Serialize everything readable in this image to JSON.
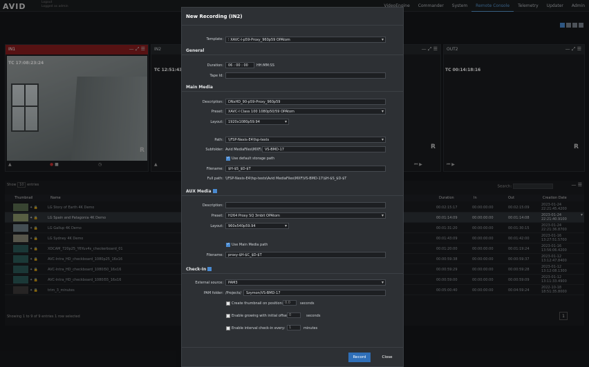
{
  "header": {
    "logo": "AVID",
    "user_line1": "Logout",
    "user_line2": "Logged as admin",
    "nav": [
      "VideoEngine",
      "Commander",
      "System",
      "Remote Console",
      "Telemetry",
      "Updater",
      "Admin"
    ],
    "active_nav": "Remote Console"
  },
  "channels": [
    {
      "name": "IN1",
      "tc": "TC 17:08:23:24"
    },
    {
      "name": "IN2",
      "tc": "TC 12:51:43:26"
    },
    {
      "name": "OUT2",
      "tc": "TC 00:14:18:16"
    }
  ],
  "list": {
    "show_label": "Show",
    "show_value": "10",
    "entries_label": "entries",
    "search_label": "Search:",
    "columns": [
      "Thumbnail",
      "Name",
      "Duration",
      "In",
      "Out",
      "Creation Date"
    ],
    "rows": [
      {
        "name": "LG Story of Earth 4K Demo",
        "dur": "00:02:15:17",
        "in": "00:00:00:00",
        "out": "00:02:15:09",
        "date": "2023-01-24 22:21:45.4200"
      },
      {
        "name": "LG Spain and Patagonia 4K Demo",
        "dur": "00:01:14:09",
        "in": "00:00:00:00",
        "out": "00:01:14:08",
        "date": "2023-01-24 22:21:40.9100"
      },
      {
        "name": "LG Gallup 4K Demo",
        "dur": "00:01:31:20",
        "in": "00:00:00:00",
        "out": "00:01:30:15",
        "date": "2023-01-24 22:21:36.8700"
      },
      {
        "name": "LG Sydney 4K Demo",
        "dur": "00:01:43:09",
        "in": "00:00:00:00",
        "out": "00:01:42:00",
        "date": "2023-01-16 13:27:51.5700"
      },
      {
        "name": "XDCAM_720p25_Y6Yuv4s_checkerboard_01",
        "dur": "00:01:20:00",
        "in": "00:00:00:00",
        "out": "00:01:19:24",
        "date": "2023-01-16 13:56:06.4200"
      },
      {
        "name": "AVC-Intra_HD_checkboard_1080p25_16x16",
        "dur": "00:00:59:38",
        "in": "00:00:00:00",
        "out": "00:00:59:37",
        "date": "2023-01-12 13:12:47.8400"
      },
      {
        "name": "AVC-Intra_HD_checkboard_1080i50_16x16",
        "dur": "00:00:59:29",
        "in": "00:00:00:00",
        "out": "00:00:59:28",
        "date": "2023-01-12 13:12:08.1300"
      },
      {
        "name": "AVC-Intra_HD_checkboard_1080i55_16x16",
        "dur": "00:00:59:00",
        "in": "00:00:00:00",
        "out": "00:00:59:09",
        "date": "2023-01-12 13:11:33.4900"
      },
      {
        "name": "trim_3_minutes",
        "dur": "00:05:00:40",
        "in": "00:00:00:00",
        "out": "00:04:59:24",
        "date": "2022-10-18 18:51:35.8000"
      }
    ],
    "footer": "Showing 1 to 9 of 9 entries   1 row selected",
    "page": "1"
  },
  "modal": {
    "title": "New Recording (IN2)",
    "template_label": "Template:",
    "template": "XAVC-I-p59-Proxy_960p59 OPAtom",
    "general": "General",
    "duration_label": "Duration:",
    "dur_h": "06",
    "dur_m": "00",
    "dur_s": "00",
    "dur_fmt": "HH:MM:SS",
    "tapeid_label": "Tape Id:",
    "main_media": "Main Media",
    "desc_label": "Description:",
    "desc": "DNxHD_90-p59-Proxy_960p59",
    "preset_label": "Preset:",
    "preset": "XAVC-I Class 100 1080p50/59 OPAtom",
    "layout_label": "Layout:",
    "layout": "1920x1080p59.94",
    "path_label": "Path:",
    "path": "\\\\FSP-Nexis-E4\\fsp-tests",
    "subfolder_label": "Subfolder:",
    "subfolder_prefix": "Avid MediaFiles\\MXF\\",
    "subfolder": "VS-BMD-17",
    "default_storage": "Use default storage path",
    "filename_label": "Filename:",
    "filename": "$H-$S_$D-$T",
    "fullpath_label": "Full path:",
    "fullpath": "\\\\FSP-Nexis-E4\\fsp-tests\\Avid MediaFiles\\MXF\\VS-BMD-17\\$H-$S_$D-$T",
    "aux_media": "AUX Media",
    "aux_desc_label": "Description:",
    "aux_preset_label": "Preset:",
    "aux_preset": "H264 Proxy SQ 3mbit OPAtom",
    "aux_layout_label": "Layout:",
    "aux_layout": "960x540p59.94",
    "use_main_path": "Use Main Media path",
    "aux_filename_label": "Filename:",
    "aux_filename": "proxy-$H-$C_$D-$T",
    "checkin": "Check-In",
    "ext_source_label": "External source:",
    "ext_source": "PAM3",
    "pam_folder_label": "PAM folder:",
    "pam_prefix": "/Projects/",
    "pam_folder": "Szymon/VS-BMD-17",
    "thumb_opt": "Create thumbnail on position:",
    "thumb_val": "0.0",
    "seconds": "seconds",
    "grow_opt": "Enable growing with initial offset:",
    "grow_val": "0",
    "interval_opt": "Enable interval check-in every:",
    "interval_val": "1",
    "minutes": "minutes",
    "record": "Record",
    "close": "Close"
  }
}
